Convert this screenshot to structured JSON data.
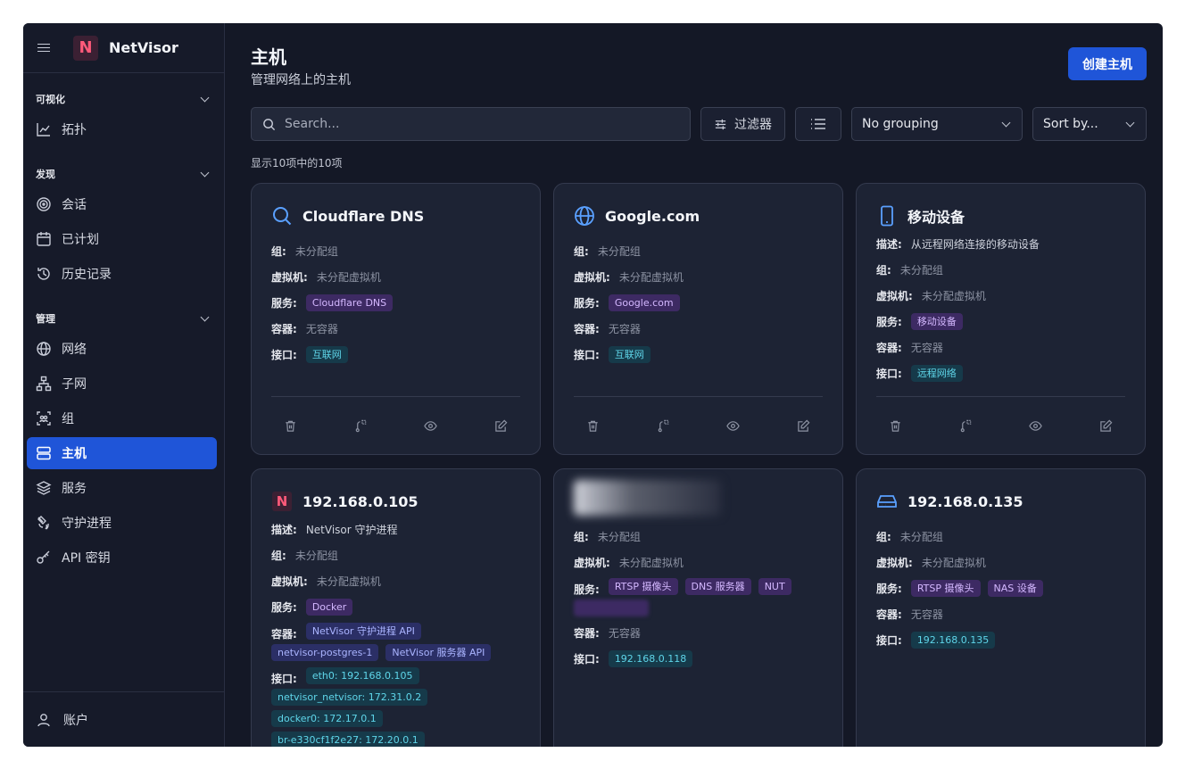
{
  "app": {
    "name": "NetVisor"
  },
  "sidebar": {
    "sections": [
      {
        "title": "可视化",
        "items": [
          {
            "label": "拓扑",
            "icon": "chart-icon"
          }
        ]
      },
      {
        "title": "发现",
        "items": [
          {
            "label": "会话",
            "icon": "radar-icon"
          },
          {
            "label": "已计划",
            "icon": "calendar-icon"
          },
          {
            "label": "历史记录",
            "icon": "history-icon"
          }
        ]
      },
      {
        "title": "管理",
        "items": [
          {
            "label": "网络",
            "icon": "globe-icon"
          },
          {
            "label": "子网",
            "icon": "network-icon"
          },
          {
            "label": "组",
            "icon": "group-icon"
          },
          {
            "label": "主机",
            "icon": "server-icon",
            "active": true
          },
          {
            "label": "服务",
            "icon": "layers-icon"
          },
          {
            "label": "守护进程",
            "icon": "satellite-icon"
          },
          {
            "label": "API 密钥",
            "icon": "key-icon"
          }
        ]
      }
    ],
    "account": "账户"
  },
  "header": {
    "title": "主机",
    "subtitle": "管理网络上的主机",
    "create_label": "创建主机"
  },
  "toolbar": {
    "search_placeholder": "Search...",
    "filter_label": "过滤器",
    "grouping": "No grouping",
    "sort": "Sort by..."
  },
  "count_text": "显示10项中的10项",
  "labels": {
    "desc": "描述:",
    "group": "组:",
    "vm": "虚拟机:",
    "services": "服务:",
    "containers": "容器:",
    "interfaces": "接口:"
  },
  "cards": [
    {
      "title": "Cloudflare DNS",
      "icon": "search-icon",
      "group": "未分配组",
      "vm": "未分配虚拟机",
      "services": [
        "Cloudflare DNS"
      ],
      "containers_text": "无容器",
      "interfaces": [
        "互联网"
      ]
    },
    {
      "title": "Google.com",
      "icon": "globe-icon",
      "group": "未分配组",
      "vm": "未分配虚拟机",
      "services": [
        "Google.com"
      ],
      "containers_text": "无容器",
      "interfaces": [
        "互联网"
      ]
    },
    {
      "title": "移动设备",
      "icon": "phone-icon",
      "desc": "从远程网络连接的移动设备",
      "group": "未分配组",
      "vm": "未分配虚拟机",
      "services": [
        "移动设备"
      ],
      "containers_text": "无容器",
      "interfaces": [
        "远程网络"
      ]
    },
    {
      "title": "192.168.0.105",
      "icon": "netvisor-logo-icon",
      "desc": "NetVisor 守护进程",
      "group": "未分配组",
      "vm": "未分配虚拟机",
      "services": [
        "Docker"
      ],
      "containers": [
        "NetVisor 守护进程 API",
        "netvisor-postgres-1",
        "NetVisor 服务器 API"
      ],
      "interfaces": [
        "eth0: 192.168.0.105",
        "netvisor_netvisor: 172.31.0.2",
        "docker0: 172.17.0.1",
        "br-e330cf1f2e27: 172.20.0.1"
      ]
    },
    {
      "title": "",
      "icon": "",
      "group": "未分配组",
      "vm": "未分配虚拟机",
      "services": [
        "RTSP 摄像头",
        "DNS 服务器",
        "NUT"
      ],
      "containers_text": "无容器",
      "interfaces": [
        "192.168.0.118"
      ]
    },
    {
      "title": "192.168.0.135",
      "icon": "nas-drive-icon",
      "group": "未分配组",
      "vm": "未分配虚拟机",
      "services": [
        "RTSP 摄像头",
        "NAS 设备"
      ],
      "containers_text": "无容器",
      "interfaces": [
        "192.168.0.135"
      ]
    }
  ]
}
